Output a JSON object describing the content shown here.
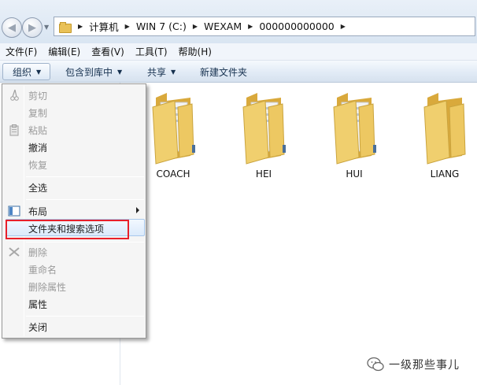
{
  "address_bar": {
    "breadcrumbs": [
      "计算机",
      "WIN 7 (C:)",
      "WEXAM",
      "000000000000"
    ]
  },
  "menu_bar": {
    "items": [
      "文件(F)",
      "编辑(E)",
      "查看(V)",
      "工具(T)",
      "帮助(H)"
    ]
  },
  "command_bar": {
    "organize": "组织",
    "include_in_library": "包含到库中",
    "share": "共享",
    "new_folder": "新建文件夹"
  },
  "folders": [
    {
      "name": "COACH"
    },
    {
      "name": "HEI"
    },
    {
      "name": "HUI"
    },
    {
      "name": "LIANG"
    }
  ],
  "context_menu": {
    "items": [
      {
        "label": "剪切",
        "enabled": false,
        "icon": "scissors-icon"
      },
      {
        "label": "复制",
        "enabled": false,
        "icon": ""
      },
      {
        "label": "粘贴",
        "enabled": false,
        "icon": "clipboard-icon"
      },
      {
        "label": "撤消",
        "enabled": true,
        "icon": ""
      },
      {
        "label": "恢复",
        "enabled": false,
        "icon": ""
      },
      {
        "label": "全选",
        "enabled": true,
        "icon": ""
      },
      {
        "label": "布局",
        "enabled": true,
        "icon": "layout-icon",
        "submenu": true
      },
      {
        "label": "文件夹和搜索选项",
        "enabled": true,
        "icon": "",
        "highlighted": true
      },
      {
        "label": "删除",
        "enabled": false,
        "icon": "delete-x-icon"
      },
      {
        "label": "重命名",
        "enabled": false,
        "icon": ""
      },
      {
        "label": "删除属性",
        "enabled": false,
        "icon": ""
      },
      {
        "label": "属性",
        "enabled": true,
        "icon": ""
      },
      {
        "label": "关闭",
        "enabled": true,
        "icon": ""
      }
    ]
  },
  "watermark": {
    "text": "一级那些事儿"
  },
  "colors": {
    "highlight_box": "#e8202a",
    "folder": "#e9c157"
  }
}
